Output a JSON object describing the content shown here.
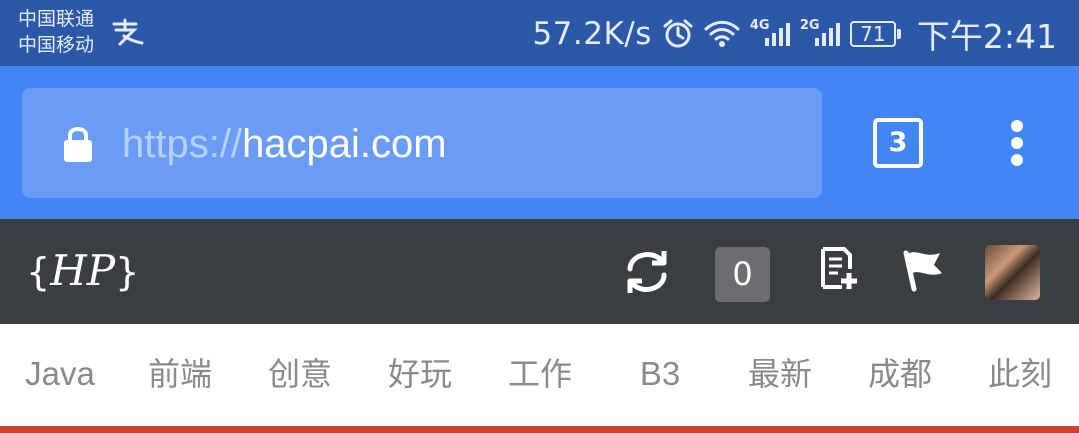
{
  "status_bar": {
    "carrier_1": "中国联通",
    "carrier_2": "中国移动",
    "net_speed": "57.2K/s",
    "net_tag_1": "4G",
    "net_tag_2": "2G",
    "battery": "71",
    "time": "下午2:41"
  },
  "browser": {
    "url_scheme": "https://",
    "url_host": "hacpai.com",
    "tab_count": "3"
  },
  "site_header": {
    "logo_open": "{",
    "logo_text": "HP",
    "logo_close": "}",
    "notification_count": "0"
  },
  "categories": [
    "Java",
    "前端",
    "创意",
    "好玩",
    "工作",
    "B3",
    "最新",
    "成都",
    "此刻"
  ],
  "colors": {
    "status_bar_bg": "#2b58a8",
    "browser_bar_bg": "#4285f4",
    "site_header_bg": "#3a3d42",
    "active_line": "#d23f31"
  }
}
